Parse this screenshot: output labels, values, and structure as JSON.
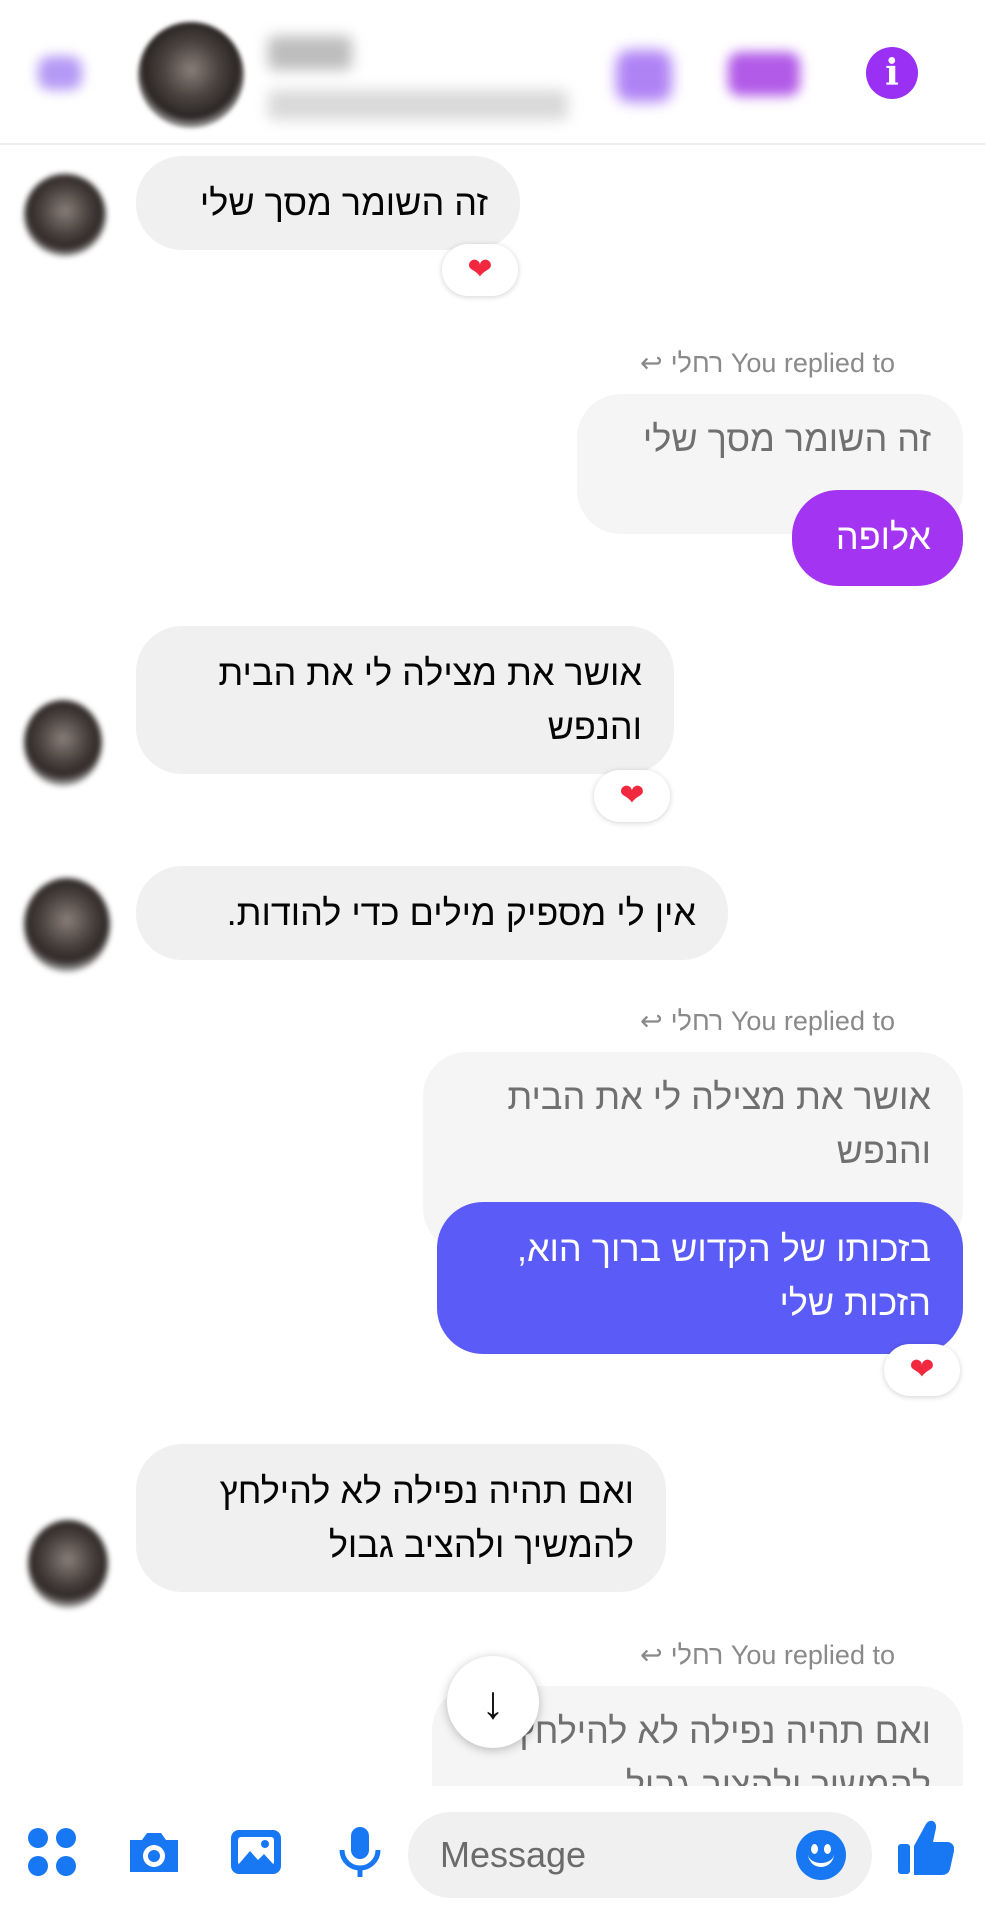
{
  "header": {
    "info_symbol": "i",
    "accent_color": "#9b30f5"
  },
  "messages": {
    "m1": {
      "text": "זה השומר מסך שלי",
      "reaction": "❤"
    },
    "r1": {
      "replied_label": "רחלי You replied to",
      "quoted": "זה השומר מסך שלי",
      "text": "אלופה",
      "color": "#a334f2"
    },
    "m2": {
      "line1": "אושר את מצילה לי את הבית",
      "line2": "והנפש",
      "reaction": "❤"
    },
    "m3": {
      "text": "אין לי מספיק מילים כדי להודות."
    },
    "r2": {
      "replied_label": "רחלי You replied to",
      "quoted_line1": "אושר את מצילה לי את הבית",
      "quoted_line2": "והנפש",
      "line1": "בזכותו של הקדוש ברוך הוא,",
      "line2": "הזכות שלי",
      "color": "#5b5bf7",
      "reaction": "❤"
    },
    "m4": {
      "line1": "ואם תהיה נפילה לא להילחץ",
      "line2": "להמשיך ולהציב גבול"
    },
    "r3": {
      "replied_label": "רחלי You replied to",
      "quoted_line1": "ואם תהיה נפילה לא להילחץ",
      "quoted_line2": "להמשיך ולהציב גבול"
    }
  },
  "scroll_down_icon": "↓",
  "composer": {
    "placeholder": "Message",
    "icons": [
      "apps-icon",
      "camera-icon",
      "gallery-icon",
      "microphone-icon",
      "emoji-icon",
      "like-icon"
    ],
    "icon_color": "#1877f2"
  }
}
